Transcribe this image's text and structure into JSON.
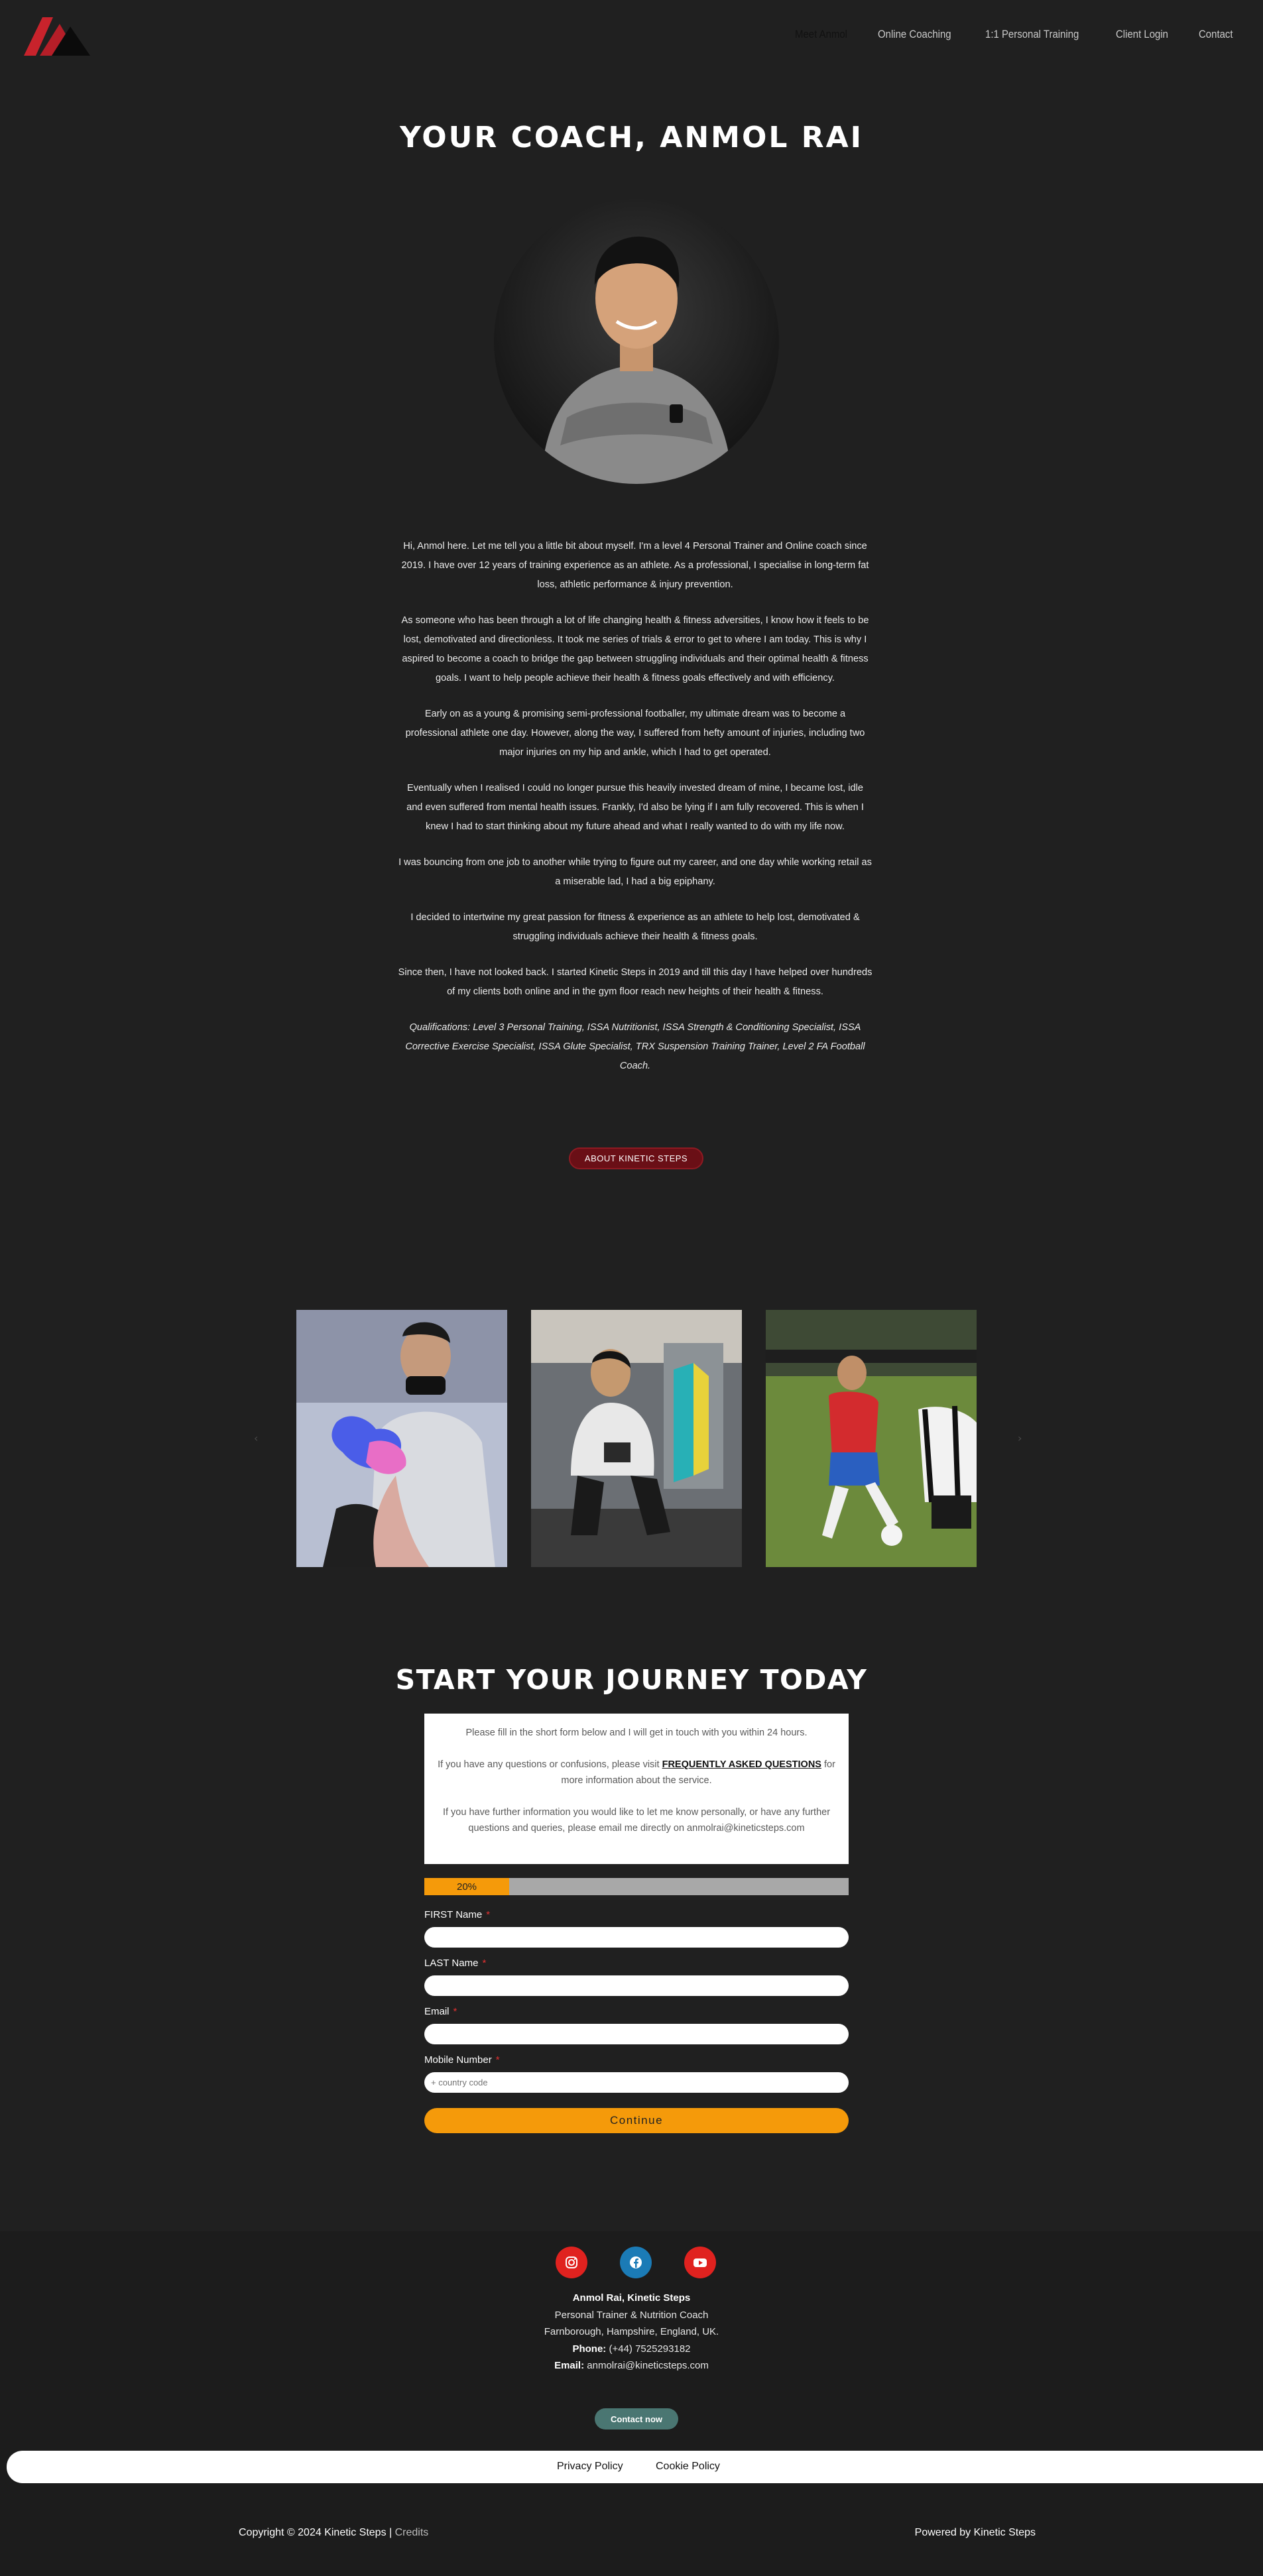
{
  "nav": {
    "items": [
      "Meet Anmol",
      "Online Coaching",
      "1:1 Personal Training",
      "Client Login",
      "Contact"
    ]
  },
  "hero": {
    "title": "YOUR COACH, ANMOL RAI"
  },
  "bio": {
    "paragraphs": [
      "Hi, Anmol here. Let me tell you a little bit about myself. I'm a level 4 Personal Trainer and Online coach since 2019. I have over 12 years of training experience as an athlete. As a professional, I specialise in long-term fat loss, athletic performance & injury prevention.",
      "As someone who has been through a lot of life changing health & fitness adversities, I know how it feels to be lost, demotivated and directionless. It took me series of trials & error to get to where I am today. This is why I aspired to become a coach to bridge the gap between struggling individuals and their optimal health & fitness goals. I want to help people achieve their health & fitness goals effectively and with efficiency.",
      "Early on as a young & promising semi-professional footballer, my ultimate dream was to become a professional athlete one day. However, along the way, I suffered from hefty amount of injuries, including two major injuries on my hip and ankle, which I had to get operated.",
      "Eventually when I realised I could no longer pursue this heavily invested dream of mine, I became lost, idle and even suffered from mental health issues. Frankly, I'd also be lying if I am fully recovered. This is when I knew I had to start thinking about my future ahead and what I really wanted to do with my life now.",
      "I was bouncing from one job to another while trying to figure out my career, and one day while working retail as a miserable lad, I had a big epiphany.",
      "I decided to intertwine my great passion for fitness & experience as an athlete to help lost, demotivated & struggling individuals achieve their health & fitness goals.",
      "Since then, I have not looked back. I started Kinetic Steps in 2019 and till this day I have helped over hundreds of my clients both online and in the gym floor reach new heights of their health & fitness."
    ],
    "qualifications": "Qualifications: Level 3 Personal Training, ISSA Nutritionist, ISSA Strength & Conditioning Specialist, ISSA Corrective Exercise Specialist, ISSA Glute Specialist, TRX Suspension Training Trainer, Level 2 FA Football Coach.",
    "about_button": "ABOUT KINETIC STEPS"
  },
  "gallery": {
    "prev": "‹",
    "next": "›"
  },
  "journey": {
    "title": "START YOUR JOURNEY TODAY",
    "info_1": "Please fill in the short form below and I will get in touch with you within 24 hours.",
    "info_2_pre": "If you have any questions or confusions, please visit ",
    "info_2_link": "FREQUENTLY ASKED QUESTIONS",
    "info_2_post": " for more information about the service.",
    "info_3": "If you have further information you would like to let me know personally, or have any further questions and queries, please email me directly on anmolrai@kineticsteps.com",
    "progress_label": "20%",
    "progress_value": 0.2,
    "first_name_label": "FIRST Name",
    "last_name_label": "LAST Name",
    "email_label": "Email",
    "mobile_label": "Mobile Number",
    "required_mark": "*",
    "mobile_placeholder": "+ country code",
    "continue_button": "Continue"
  },
  "footer": {
    "socials": [
      "instagram-icon",
      "facebook-icon",
      "youtube-icon"
    ],
    "social_colors": [
      "#e0221f",
      "#1b7bb6",
      "#e0221f"
    ],
    "name": "Anmol Rai, Kinetic Steps",
    "role": "Personal Trainer & Nutrition Coach",
    "location": "Farnborough, Hampshire, England, UK.",
    "phone_label": "Phone:",
    "phone": "(+44) 7525293182",
    "email_label": "Email:",
    "email": "anmolrai@kineticsteps.com",
    "contact_button": "Contact now",
    "privacy": "Privacy Policy",
    "cookie": "Cookie Policy",
    "copyright": "Copyright © 2024 Kinetic Steps | ",
    "credits": "Credits",
    "powered": "Powered by Kinetic Steps"
  }
}
